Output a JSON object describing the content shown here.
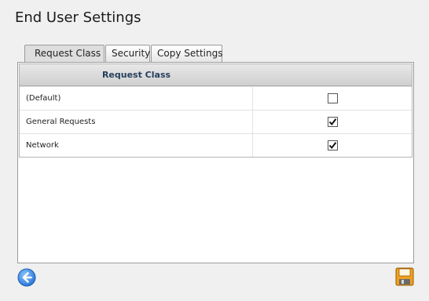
{
  "page": {
    "title": "End User Settings"
  },
  "tabs": [
    {
      "label": "Request Class",
      "active": true
    },
    {
      "label": "Security",
      "active": false
    },
    {
      "label": "Copy Settings",
      "active": false
    }
  ],
  "grid": {
    "header": "Request Class",
    "rows": [
      {
        "label": "(Default)",
        "checked": false
      },
      {
        "label": "General Requests",
        "checked": true
      },
      {
        "label": "Network",
        "checked": true
      }
    ]
  },
  "footer": {
    "back_icon": "back-arrow-icon",
    "save_icon": "save-floppy-icon",
    "accent_color": "#3a8ee6",
    "save_color": "#f0a020"
  }
}
